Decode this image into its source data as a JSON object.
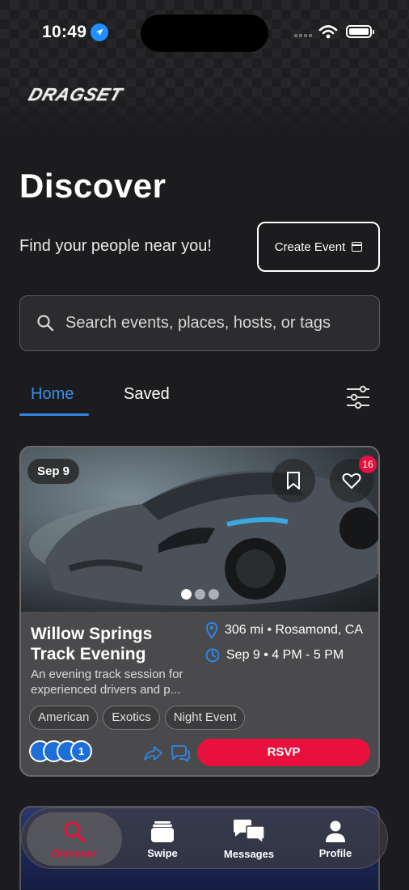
{
  "status_bar": {
    "time": "10:49"
  },
  "brand": {
    "logo_text": "DRAGSET"
  },
  "header": {
    "title": "Discover",
    "subtitle": "Find your people near you!",
    "create_button_label": "Create Event"
  },
  "search": {
    "placeholder": "Search events, places, hosts, or tags"
  },
  "tabs": [
    {
      "label": "Home",
      "active": true
    },
    {
      "label": "Saved",
      "active": false
    }
  ],
  "event": {
    "date_chip": "Sep 9",
    "likes_badge": "16",
    "title": "Willow Springs Track Evening",
    "description": "An evening track session for experienced drivers and p...",
    "distance_location": "306 mi • Rosamond, CA",
    "datetime": "Sep 9 • 4 PM - 5 PM",
    "tags": [
      "American",
      "Exotics",
      "Night Event"
    ],
    "attendee_count": "1",
    "rsvp_label": "RSVP",
    "image_index": 0,
    "image_count": 3
  },
  "nav": {
    "items": [
      {
        "label": "Discover",
        "icon": "search-icon",
        "active": true
      },
      {
        "label": "Swipe",
        "icon": "cards-icon",
        "active": false
      },
      {
        "label": "Messages",
        "icon": "chat-bubbles-icon",
        "active": false
      },
      {
        "label": "Profile",
        "icon": "person-icon",
        "active": false
      }
    ]
  },
  "colors": {
    "accent": "#e8103c",
    "tab_active": "#3a8fe8",
    "background": "#1c1c1e"
  }
}
